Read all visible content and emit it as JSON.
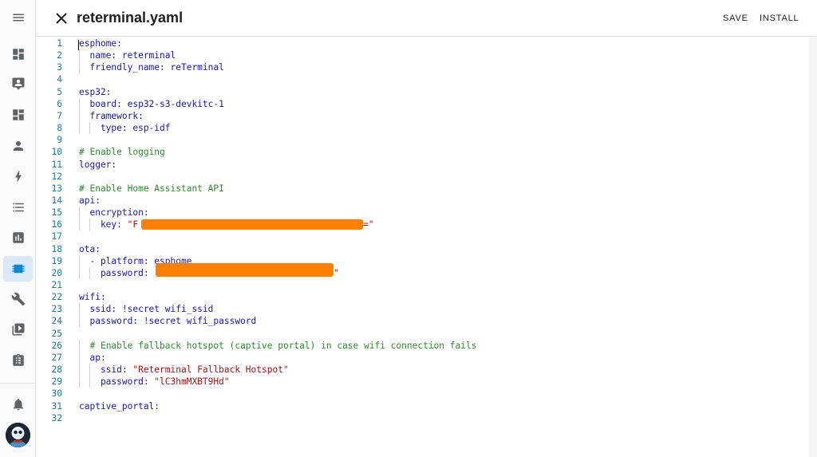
{
  "header": {
    "title": "reterminal.yaml",
    "save_label": "SAVE",
    "install_label": "INSTALL"
  },
  "sidebar": {
    "items": [
      {
        "icon": "menu-icon"
      },
      {
        "icon": "dashboard-icon"
      },
      {
        "icon": "energy-icon"
      },
      {
        "icon": "map-icon"
      },
      {
        "icon": "person-icon"
      },
      {
        "icon": "lightning-icon"
      },
      {
        "icon": "list-icon"
      },
      {
        "icon": "chart-icon"
      },
      {
        "icon": "esphome-icon",
        "active": true
      },
      {
        "icon": "wrench-icon"
      },
      {
        "icon": "media-icon"
      },
      {
        "icon": "clipboard-icon"
      },
      {
        "icon": "bell-icon"
      },
      {
        "icon": "avatar"
      }
    ]
  },
  "editor": {
    "lines": [
      {
        "n": "1",
        "t": "esphome:"
      },
      {
        "n": "2",
        "t": "  name: reterminal"
      },
      {
        "n": "3",
        "t": "  friendly_name: reTerminal"
      },
      {
        "n": "4",
        "t": ""
      },
      {
        "n": "5",
        "t": "esp32:"
      },
      {
        "n": "6",
        "t": "  board: esp32-s3-devkitc-1"
      },
      {
        "n": "7",
        "t": "  framework:"
      },
      {
        "n": "8",
        "t": "    type: esp-idf"
      },
      {
        "n": "9",
        "t": ""
      },
      {
        "n": "10",
        "t": "# Enable logging"
      },
      {
        "n": "11",
        "t": "logger:"
      },
      {
        "n": "12",
        "t": ""
      },
      {
        "n": "13",
        "t": "# Enable Home Assistant API"
      },
      {
        "n": "14",
        "t": "api:"
      },
      {
        "n": "15",
        "t": "  encryption:"
      },
      {
        "n": "16",
        "t": "    key: \"F"
      },
      {
        "n": "17",
        "t": ""
      },
      {
        "n": "18",
        "t": "ota:"
      },
      {
        "n": "19",
        "t": "  - platform: esphome"
      },
      {
        "n": "20",
        "t": "    password: "
      },
      {
        "n": "21",
        "t": ""
      },
      {
        "n": "22",
        "t": "wifi:"
      },
      {
        "n": "23",
        "t": "  ssid: !secret wifi_ssid"
      },
      {
        "n": "24",
        "t": "  password: !secret wifi_password"
      },
      {
        "n": "25",
        "t": ""
      },
      {
        "n": "26",
        "t": "  # Enable fallback hotspot (captive portal) in case wifi connection fails"
      },
      {
        "n": "27",
        "t": "  ap:"
      },
      {
        "n": "28",
        "t": "    ssid: \"Reterminal Fallback Hotspot\""
      },
      {
        "n": "29",
        "t": "    password: \"lC3hmMXBT9Hd\""
      },
      {
        "n": "30",
        "t": ""
      },
      {
        "n": "31",
        "t": "captive_portal:"
      },
      {
        "n": "32",
        "t": ""
      }
    ],
    "key16_tail": "=\"",
    "pw20_tail": "\""
  },
  "colors": {
    "accent": "#0288d1",
    "redaction": "#ff7f00",
    "comment": "#2e8b2e",
    "string": "#a31515",
    "keyword": "#1a1aa6",
    "line_number": "#237893"
  }
}
